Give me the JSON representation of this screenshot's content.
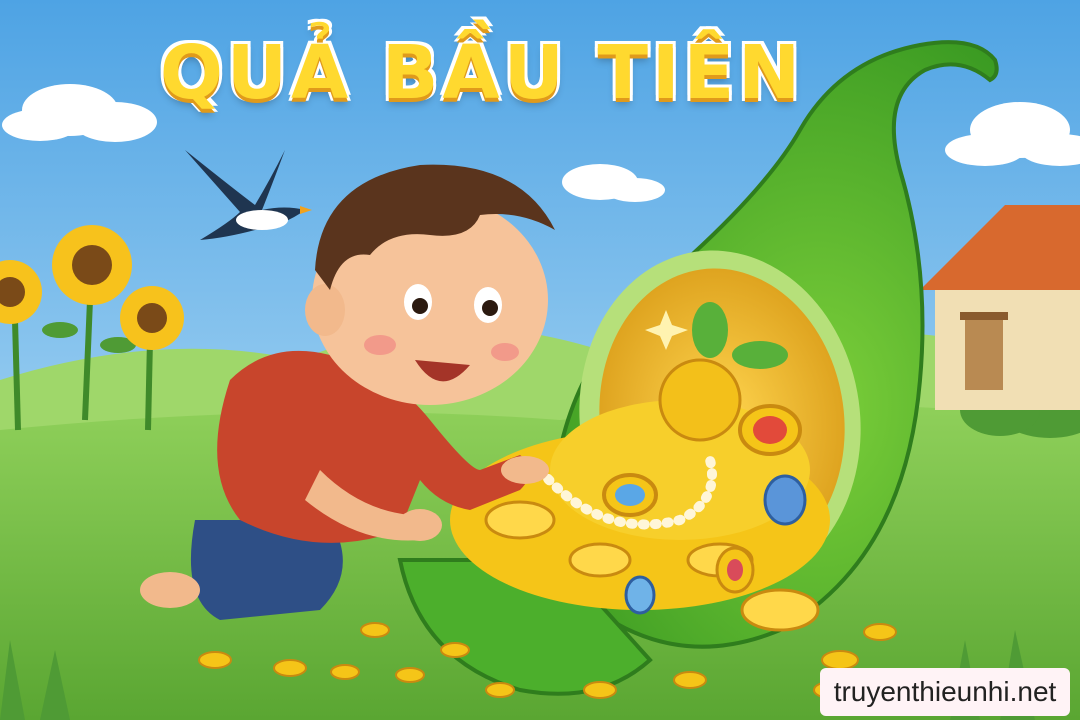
{
  "title": "QUẢ BẦU TIÊN",
  "watermark": "truyenthieunhi.net",
  "colors": {
    "sky_top": "#5aa9e6",
    "sky_bottom": "#bfe3f7",
    "grass": "#7cc24a",
    "gourd": "#4caf2c",
    "gold": "#f5c518",
    "title_fill": "#ffd92f",
    "shirt": "#c8452c",
    "pants": "#2e4f86"
  },
  "icons": [
    "bird-icon",
    "sunflower-icon",
    "house-icon",
    "gourd-icon",
    "coins-icon",
    "gem-icon",
    "cloud-icon",
    "sparkle-icon"
  ]
}
